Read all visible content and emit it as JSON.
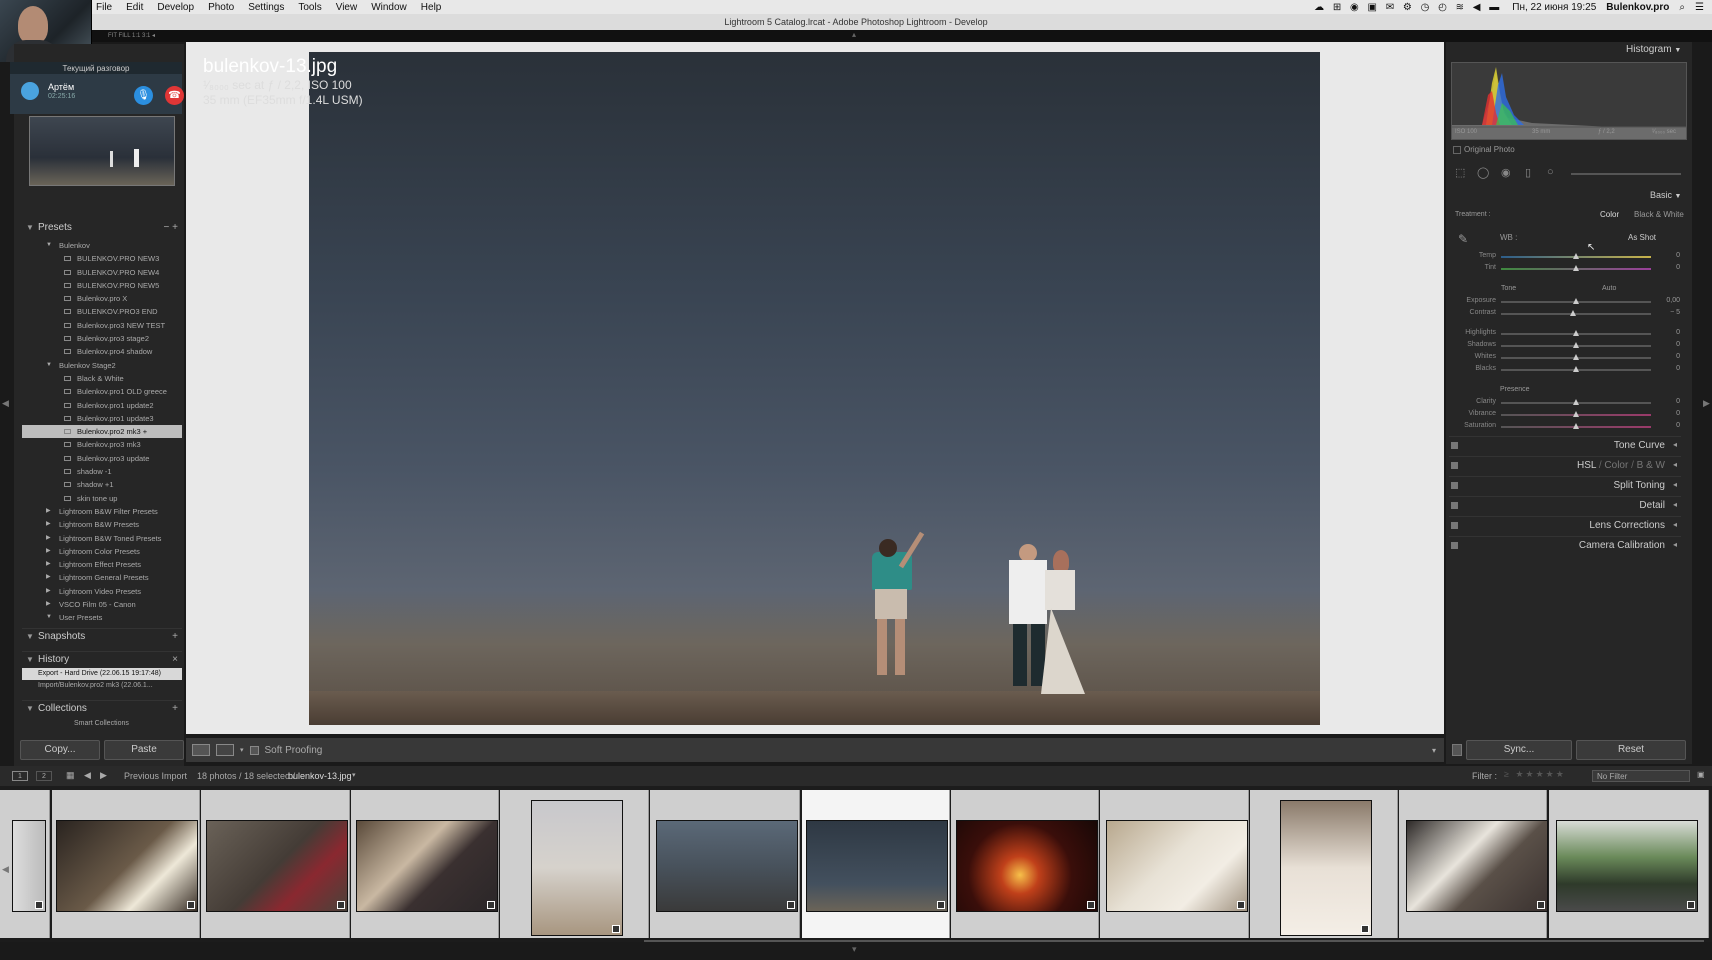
{
  "menubar": {
    "menus": [
      "File",
      "Edit",
      "Develop",
      "Photo",
      "Settings",
      "Tools",
      "View",
      "Window",
      "Help"
    ],
    "date_time": "Пн, 22 июня  19:25",
    "user": "Bulenkov.pro"
  },
  "window": {
    "title": "Lightroom 5 Catalog.lrcat - Adobe Photoshop Lightroom - Develop"
  },
  "call": {
    "title": "Текущий разговор",
    "name": "Артём",
    "duration": "02:25:16"
  },
  "left_panel": {
    "presets_label": "Presets",
    "presets": [
      {
        "kind": "folder",
        "label": "Bulenkov"
      },
      {
        "kind": "item",
        "label": "BULENKOV.PRO NEW3"
      },
      {
        "kind": "item",
        "label": "BULENKOV.PRO NEW4"
      },
      {
        "kind": "item",
        "label": "BULENKOV.PRO NEW5"
      },
      {
        "kind": "item",
        "label": "Bulenkov.pro X"
      },
      {
        "kind": "item",
        "label": "BULENKOV.PRO3 END"
      },
      {
        "kind": "item",
        "label": "Bulenkov.pro3 NEW TEST"
      },
      {
        "kind": "item",
        "label": "Bulenkov.pro3 stage2"
      },
      {
        "kind": "item",
        "label": "Bulenkov.pro4 shadow"
      },
      {
        "kind": "folder",
        "label": "Bulenkov Stage2"
      },
      {
        "kind": "item",
        "label": "Black & White"
      },
      {
        "kind": "item",
        "label": "Bulenkov.pro1 OLD greece"
      },
      {
        "kind": "item",
        "label": "Bulenkov.pro1 update2"
      },
      {
        "kind": "item",
        "label": "Bulenkov.pro1 update3"
      },
      {
        "kind": "item",
        "label": "Bulenkov.pro2 mk3",
        "selected": true
      },
      {
        "kind": "item",
        "label": "Bulenkov.pro3 mk3"
      },
      {
        "kind": "item",
        "label": "Bulenkov.pro3 update"
      },
      {
        "kind": "item",
        "label": "shadow -1"
      },
      {
        "kind": "item",
        "label": "shadow +1"
      },
      {
        "kind": "item",
        "label": "skin tone up"
      },
      {
        "kind": "group",
        "label": "Lightroom B&W Filter Presets"
      },
      {
        "kind": "group",
        "label": "Lightroom B&W Presets"
      },
      {
        "kind": "group",
        "label": "Lightroom B&W Toned Presets"
      },
      {
        "kind": "group",
        "label": "Lightroom Color Presets"
      },
      {
        "kind": "group",
        "label": "Lightroom Effect Presets"
      },
      {
        "kind": "group",
        "label": "Lightroom General Presets"
      },
      {
        "kind": "group",
        "label": "Lightroom Video Presets"
      },
      {
        "kind": "group",
        "label": "VSCO Film 05 - Canon"
      },
      {
        "kind": "folder",
        "label": "User Presets"
      }
    ],
    "snapshots_label": "Snapshots",
    "history_label": "History",
    "history": [
      {
        "label": "Export - Hard Drive (22.06.15 19:17:48)",
        "selected": true
      },
      {
        "label": "Import/Bulenkov.pro2 mk3 (22.06.1...",
        "selected": false
      }
    ],
    "collections_label": "Collections",
    "smart_collections": "Smart Collections",
    "copy_button": "Copy...",
    "paste_button": "Paste"
  },
  "photo": {
    "filename": "bulenkov-13.jpg",
    "exposure": "¹⁄₈₀₀₀ sec at ƒ / 2,2, ISO 100",
    "lens": "35 mm (EF35mm f/1.4L USM)"
  },
  "toolbar": {
    "soft_proofing": "Soft Proofing"
  },
  "right_panel": {
    "histogram_label": "Histogram",
    "histo_iso": "ISO 100",
    "histo_focal": "35 mm",
    "histo_aperture": "ƒ / 2,2",
    "histo_shutter": "¹⁄₈₀₀₀ sec",
    "original_photo": "Original Photo",
    "basic_label": "Basic",
    "treatment_label": "Treatment :",
    "treatment_color": "Color",
    "treatment_bw": "Black & White",
    "wb_label": "WB :",
    "wb_value": "As Shot",
    "tone_label": "Tone",
    "auto_label": "Auto",
    "presence_label": "Presence",
    "sliders": [
      {
        "label": "Temp",
        "value": "0"
      },
      {
        "label": "Tint",
        "value": "0"
      },
      {
        "label": "Exposure",
        "value": "0,00"
      },
      {
        "label": "Contrast",
        "value": "− 5"
      },
      {
        "label": "Highlights",
        "value": "0"
      },
      {
        "label": "Shadows",
        "value": "0"
      },
      {
        "label": "Whites",
        "value": "0"
      },
      {
        "label": "Blacks",
        "value": "0"
      },
      {
        "label": "Clarity",
        "value": "0"
      },
      {
        "label": "Vibrance",
        "value": "0"
      },
      {
        "label": "Saturation",
        "value": "0"
      }
    ],
    "sections": [
      "Tone Curve",
      "HSL / Color / B&W",
      "Split Toning",
      "Detail",
      "Lens Corrections",
      "Camera Calibration"
    ],
    "hsl_parts": [
      "HSL",
      "Color",
      "B & W"
    ],
    "sync_button": "Sync...",
    "reset_button": "Reset"
  },
  "filmstrip": {
    "source": "Previous Import",
    "count": "18 photos / 18 selected /",
    "current": "bulenkov-13.jpg",
    "filter_label": "Filter :",
    "filter_value": "No Filter",
    "page1": "1",
    "page2": "2"
  },
  "colors": {
    "accent_selected": "#bdbdbd",
    "call_mic": "#2b8fe0",
    "call_hangup": "#e03636"
  }
}
